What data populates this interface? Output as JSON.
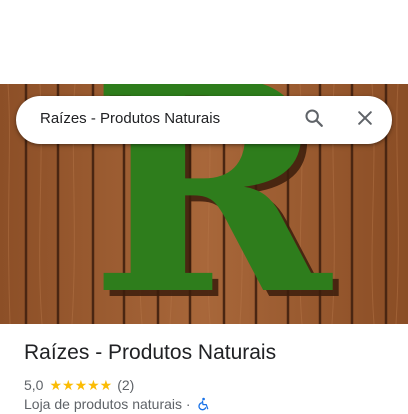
{
  "search": {
    "query": "Raízes - Produtos Naturais"
  },
  "hero": {
    "logo_letter": "R"
  },
  "place": {
    "title": "Raízes - Produtos Naturais",
    "rating_value": "5,0",
    "stars": "★★★★★",
    "review_count": "(2)",
    "category": "Loja de produtos naturais",
    "separator": "·"
  },
  "colors": {
    "wood": "#9b5a2e",
    "logo_green": "#2e7d1c",
    "star": "#fbbc04",
    "accessibility_blue": "#1a73e8"
  },
  "icons": [
    "search-icon",
    "close-icon",
    "wheelchair-icon"
  ]
}
